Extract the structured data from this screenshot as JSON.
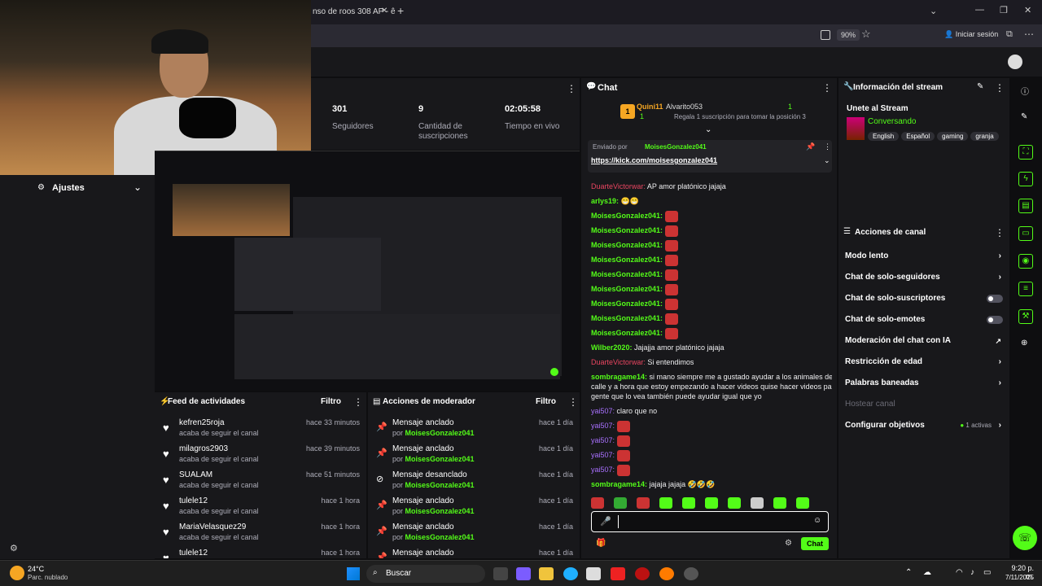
{
  "browser": {
    "tab_title": "nso de roos 308 AP - ê",
    "zoom": "90%",
    "sign_in": "Iniciar sesión"
  },
  "leftpanel": {
    "title": "Ajustes"
  },
  "stats": [
    {
      "value": "301",
      "label": "Seguidores"
    },
    {
      "value": "9",
      "label": "Cantidad de suscripciones"
    },
    {
      "value": "02:05:58",
      "label": "Tiempo en vivo"
    }
  ],
  "feed": {
    "title": "Feed de actividades",
    "filter": "Filtro",
    "items": [
      {
        "name": "kefren25roja",
        "sub": "acaba de seguir el canal",
        "time": "hace 33 minutos"
      },
      {
        "name": "milagros2903",
        "sub": "acaba de seguir el canal",
        "time": "hace 39 minutos"
      },
      {
        "name": "SUALAM",
        "sub": "acaba de seguir el canal",
        "time": "hace 51 minutos"
      },
      {
        "name": "tulele12",
        "sub": "acaba de seguir el canal",
        "time": "hace 1 hora"
      },
      {
        "name": "MariaVelasquez29",
        "sub": "acaba de seguir el canal",
        "time": "hace 1 hora"
      },
      {
        "name": "tulele12",
        "sub": "",
        "time": "hace 1 hora"
      }
    ]
  },
  "modactions": {
    "title": "Acciones de moderador",
    "filter": "Filtro",
    "items": [
      {
        "action": "Mensaje anclado",
        "by": "por",
        "user": "MoisesGonzalez041",
        "time": "hace 1 día"
      },
      {
        "action": "Mensaje anclado",
        "by": "por",
        "user": "MoisesGonzalez041",
        "time": "hace 1 día"
      },
      {
        "action": "Mensaje desanclado",
        "by": "por",
        "user": "MoisesGonzalez041",
        "time": "hace 1 día"
      },
      {
        "action": "Mensaje anclado",
        "by": "por",
        "user": "MoisesGonzalez041",
        "time": "hace 1 día"
      },
      {
        "action": "Mensaje anclado",
        "by": "por",
        "user": "MoisesGonzalez041",
        "time": "hace 1 día"
      },
      {
        "action": "Mensaje anclado",
        "by": "",
        "user": "",
        "time": "hace 1 día"
      }
    ]
  },
  "chat": {
    "title": "Chat",
    "top_user1": "Quini11",
    "top_user1_count": "1",
    "top_user2": "Alvarito053",
    "top_user2_count": "1",
    "gift_text": "Regala 1 suscripción para tomar la posición 3",
    "pinned_by_label": "Enviado por",
    "pinned_by": "MoisesGonzalez041",
    "pinned_link": "https://kick.com/moisesgonzalez041",
    "messages": [
      {
        "user": "DuarteVictorwar:",
        "text": "AP amor platónico jajaja",
        "color": "red"
      },
      {
        "user": "arlys19:",
        "text": "😁😁",
        "color": "green"
      },
      {
        "user": "MoisesGonzalez041:",
        "text": "",
        "color": "green"
      },
      {
        "user": "MoisesGonzalez041:",
        "text": "",
        "color": "green"
      },
      {
        "user": "MoisesGonzalez041:",
        "text": "",
        "color": "green"
      },
      {
        "user": "MoisesGonzalez041:",
        "text": "",
        "color": "green"
      },
      {
        "user": "MoisesGonzalez041:",
        "text": "",
        "color": "green"
      },
      {
        "user": "MoisesGonzalez041:",
        "text": "",
        "color": "green"
      },
      {
        "user": "MoisesGonzalez041:",
        "text": "",
        "color": "green"
      },
      {
        "user": "MoisesGonzalez041:",
        "text": "",
        "color": "green"
      },
      {
        "user": "MoisesGonzalez041:",
        "text": "",
        "color": "green"
      },
      {
        "user": "Wilber2020:",
        "text": "Jajajja amor platónico jajaja",
        "color": "green"
      },
      {
        "user": "DuarteVictorwar:",
        "text": "Si entendimos",
        "color": "red"
      },
      {
        "user": "sombragame14:",
        "text": "si mano siempre me a gustado ayudar a los animales de la",
        "color": "green"
      },
      {
        "user": "",
        "text": "calle y a hora que estoy empezando a hacer videos quise hacer videos para la",
        "color": ""
      },
      {
        "user": "",
        "text": "gente que lo vea también puede ayudar igual que yo",
        "color": ""
      },
      {
        "user": "yai507:",
        "text": "claro que no",
        "color": "purple"
      },
      {
        "user": "yai507:",
        "text": "",
        "color": "purple"
      },
      {
        "user": "yai507:",
        "text": "",
        "color": "purple"
      },
      {
        "user": "yai507:",
        "text": "",
        "color": "purple"
      },
      {
        "user": "yai507:",
        "text": "",
        "color": "purple"
      },
      {
        "user": "sombragame14:",
        "text": "jajaja jajaja 🤣🤣🤣",
        "color": "green"
      }
    ],
    "send_label": "Chat"
  },
  "streaminfo": {
    "title": "Información del stream",
    "stream_title": "Unete al Stream",
    "category": "Conversando",
    "tags": [
      "English",
      "Español",
      "gaming",
      "granja"
    ]
  },
  "channelactions": {
    "title": "Acciones de canal",
    "items": [
      {
        "label": "Modo lento",
        "type": "chevron"
      },
      {
        "label": "Chat de solo-seguidores",
        "type": "chevron"
      },
      {
        "label": "Chat de solo-suscriptores",
        "type": "toggle"
      },
      {
        "label": "Chat de solo-emotes",
        "type": "toggle"
      },
      {
        "label": "Moderación del chat con IA",
        "type": "link"
      },
      {
        "label": "Restricción de edad",
        "type": "chevron"
      },
      {
        "label": "Palabras baneadas",
        "type": "chevron"
      },
      {
        "label": "Hostear canal",
        "type": "disabled"
      },
      {
        "label": "Configurar objetivos",
        "type": "active"
      }
    ],
    "active_label": "1 activas"
  },
  "taskbar": {
    "weather_temp": "24°C",
    "weather_desc": "Parc. nublado",
    "search": "Buscar",
    "time": "9:20 p. m.",
    "date": "7/11/2025"
  },
  "colors": {
    "accent": "#53fc18",
    "panel": "#18181b",
    "bg": "#0e0e10"
  }
}
